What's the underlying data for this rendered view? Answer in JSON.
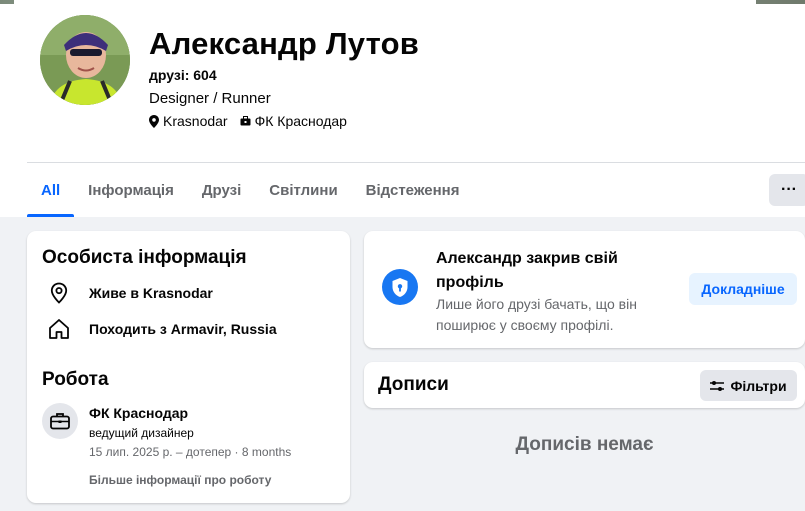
{
  "profile": {
    "name": "Александр Лутов",
    "friends": "друзі: 604",
    "bio": "Designer / Runner",
    "location": "Krasnodar",
    "club": "ФК Краснодар"
  },
  "tabs": [
    {
      "label": "All",
      "active": true
    },
    {
      "label": "Інформація",
      "active": false
    },
    {
      "label": "Друзі",
      "active": false
    },
    {
      "label": "Світлини",
      "active": false
    },
    {
      "label": "Відстеження",
      "active": false
    }
  ],
  "more_button": "···",
  "intro": {
    "title": "Особиста інформація",
    "lives_in": "Живе в Krasnodar",
    "from": "Походить з Armavir, Russia"
  },
  "work": {
    "title": "Робота",
    "company": "ФК Краснодар",
    "role": "ведущий дизайнер",
    "dates": "15 лип. 2025 р. – дотепер · 8 months",
    "more": "Більше інформації про роботу"
  },
  "locked": {
    "title": "Александр закрив свій профіль",
    "description": "Лише його друзі бачать, що він поширює у своєму профілі.",
    "button": "Докладніше"
  },
  "posts": {
    "title": "Дописи",
    "filter": "Фільтри",
    "empty": "Дописів немає"
  },
  "colors": {
    "accent": "#0866ff",
    "background": "#f0f2f5",
    "secondary_text": "#65676b"
  }
}
